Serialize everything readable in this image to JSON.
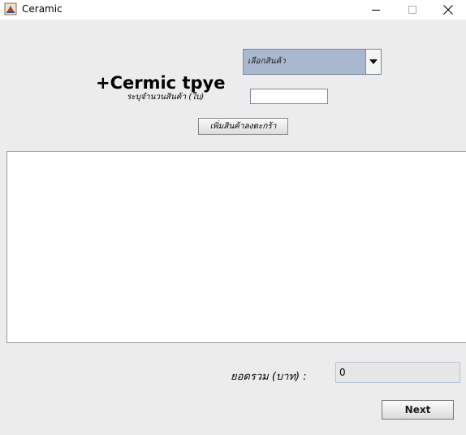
{
  "window": {
    "title": "Ceramic",
    "controls": {
      "minimize": "—",
      "maximize": "☐",
      "close": "✕"
    }
  },
  "form": {
    "heading": "+Cermic tpye",
    "product_select": {
      "selected": "เลือกสินค้า"
    },
    "quantity_label": "ระบุจำนวนสินค้า (ใบ)",
    "quantity_value": "",
    "add_button_label": "เพิ่มสินค้าลงตะกร้า"
  },
  "summary": {
    "total_label": "ยอดรวม (บาท) :",
    "total_value": "0"
  },
  "footer": {
    "next_label": "Next"
  }
}
